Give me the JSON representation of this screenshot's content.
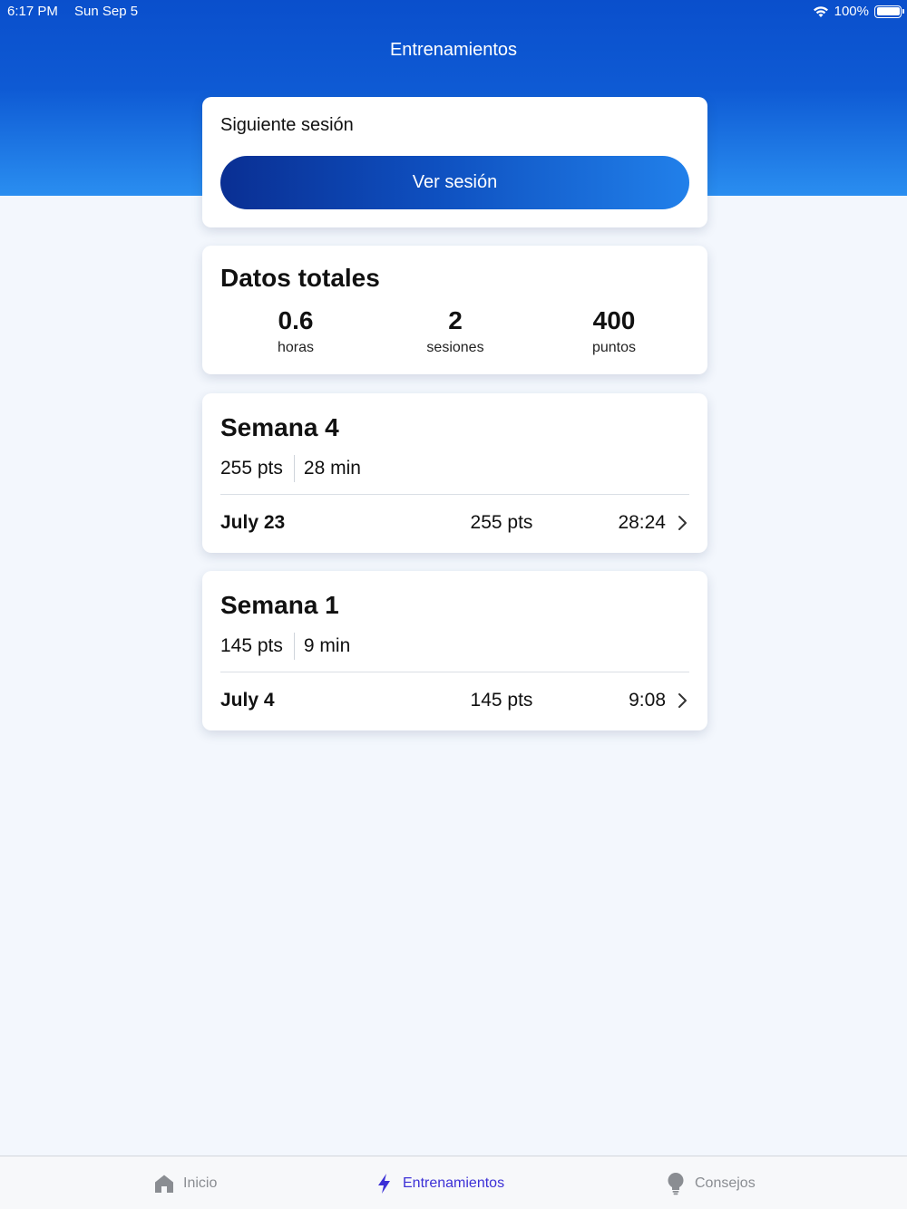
{
  "status_bar": {
    "time": "6:17 PM",
    "date": "Sun Sep 5",
    "battery": "100%",
    "icons": [
      "wifi-icon",
      "battery-icon"
    ]
  },
  "nav": {
    "title": "Entrenamientos"
  },
  "next_session": {
    "label": "Siguiente sesión",
    "button_label": "Ver sesión"
  },
  "totals": {
    "title": "Datos totales",
    "stats": [
      {
        "value": "0.6",
        "label": "horas"
      },
      {
        "value": "2",
        "label": "sesiones"
      },
      {
        "value": "400",
        "label": "puntos"
      }
    ]
  },
  "weeks": [
    {
      "title": "Semana 4",
      "points": "255 pts",
      "minutes": "28 min",
      "sessions": [
        {
          "date": "July 23",
          "points": "255 pts",
          "duration": "28:24"
        }
      ]
    },
    {
      "title": "Semana 1",
      "points": "145 pts",
      "minutes": "9 min",
      "sessions": [
        {
          "date": "July 4",
          "points": "145 pts",
          "duration": "9:08"
        }
      ]
    }
  ],
  "tabs": [
    {
      "label": "Inicio",
      "icon": "home-icon",
      "active": false
    },
    {
      "label": "Entrenamientos",
      "icon": "lightning-icon",
      "active": true
    },
    {
      "label": "Consejos",
      "icon": "lightbulb-icon",
      "active": false
    }
  ],
  "colors": {
    "header_top": "#0a4fcc",
    "header_bottom": "#2a8ef0",
    "button_start": "#0a2f93",
    "button_end": "#2180ea",
    "active_tab": "#3c30d6",
    "inactive_tab": "#8a8d92",
    "background": "#f3f7fd"
  }
}
